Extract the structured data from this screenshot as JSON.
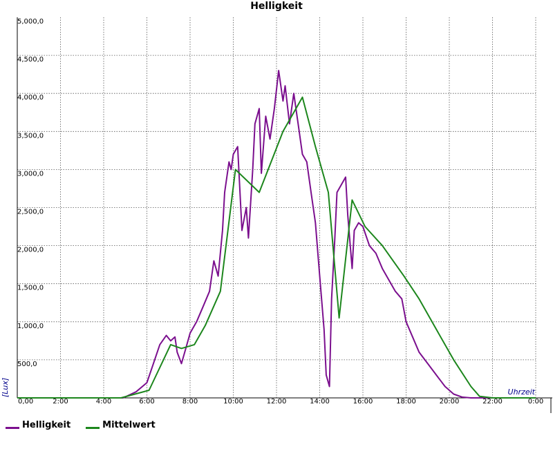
{
  "chart_data": {
    "type": "line",
    "title": "Helligkeit",
    "xlabel": "Uhrzeit",
    "ylabel": "[Lux]",
    "xlim": [
      0,
      24
    ],
    "ylim": [
      0,
      5000
    ],
    "x_ticks": [
      "0,00",
      "2:00",
      "4:00",
      "6:00",
      "8:00",
      "10:00",
      "12:00",
      "14:00",
      "16:00",
      "18:00",
      "20:00",
      "22:00",
      "0:00"
    ],
    "y_ticks": [
      "500,0",
      "1,000,0",
      "1,500,0",
      "2,000,0",
      "2,500,0",
      "3,000,0",
      "3,500,0",
      "4,000,0",
      "4,500,0",
      "5,000,0"
    ],
    "grid": true,
    "legend_position": "bottom-left",
    "series": [
      {
        "name": "Helligkeit",
        "color": "#7b0f8e",
        "x": [
          0,
          4.9,
          5.5,
          6.0,
          6.3,
          6.6,
          6.9,
          7.1,
          7.3,
          7.4,
          7.6,
          7.8,
          8.0,
          8.3,
          8.6,
          8.9,
          9.1,
          9.3,
          9.5,
          9.6,
          9.8,
          9.9,
          10.0,
          10.2,
          10.4,
          10.6,
          10.7,
          10.9,
          11.0,
          11.2,
          11.3,
          11.5,
          11.7,
          11.9,
          12.1,
          12.3,
          12.4,
          12.6,
          12.8,
          13.0,
          13.2,
          13.4,
          13.6,
          13.8,
          14.0,
          14.2,
          14.3,
          14.45,
          14.55,
          14.7,
          14.8,
          15.0,
          15.2,
          15.3,
          15.5,
          15.6,
          15.8,
          16.0,
          16.3,
          16.6,
          16.9,
          17.2,
          17.5,
          17.8,
          18.0,
          18.3,
          18.6,
          19.0,
          19.4,
          19.8,
          20.2,
          20.6,
          21.0,
          21.4,
          22.0,
          24.0
        ],
        "y": [
          0,
          0,
          80,
          200,
          450,
          700,
          820,
          750,
          800,
          600,
          450,
          650,
          850,
          1000,
          1200,
          1400,
          1800,
          1600,
          2200,
          2700,
          3100,
          3000,
          3200,
          3300,
          2200,
          2500,
          2100,
          3000,
          3600,
          3800,
          2950,
          3700,
          3400,
          3800,
          4300,
          3900,
          4100,
          3600,
          4000,
          3600,
          3200,
          3100,
          2700,
          2300,
          1600,
          900,
          300,
          150,
          1300,
          2100,
          2700,
          2800,
          2900,
          2400,
          1700,
          2200,
          2300,
          2250,
          2000,
          1900,
          1700,
          1550,
          1400,
          1300,
          1000,
          800,
          600,
          450,
          300,
          150,
          50,
          10,
          0,
          0,
          0,
          0
        ]
      },
      {
        "name": "Mittelwert",
        "color": "#1c861c",
        "x": [
          0,
          4.8,
          6.1,
          7.1,
          7.6,
          8.2,
          8.7,
          9.4,
          10.1,
          11.2,
          12.3,
          13.2,
          13.8,
          14.4,
          14.9,
          15.5,
          16.1,
          16.9,
          17.9,
          18.6,
          19.4,
          20.2,
          21.0,
          21.4,
          22.0,
          24.0
        ],
        "y": [
          0,
          0,
          100,
          700,
          650,
          700,
          950,
          1400,
          3000,
          2700,
          3500,
          3950,
          3300,
          2700,
          1050,
          2600,
          2250,
          2000,
          1600,
          1300,
          900,
          500,
          150,
          20,
          0,
          0
        ]
      }
    ]
  }
}
